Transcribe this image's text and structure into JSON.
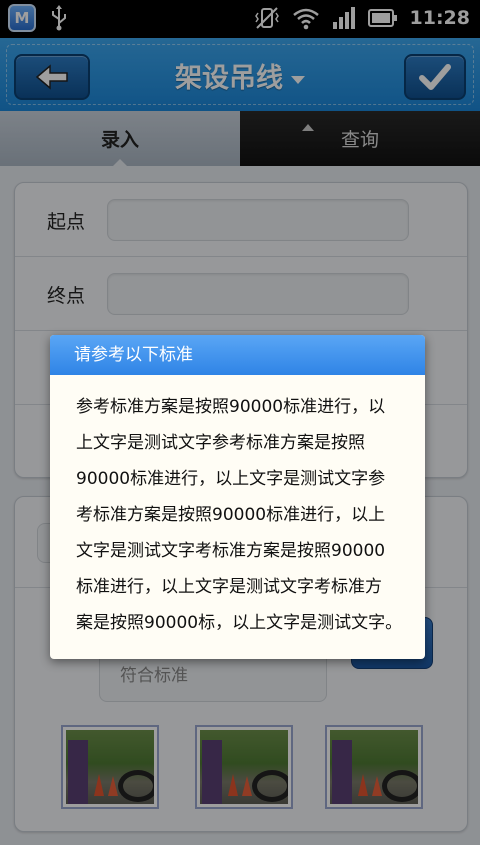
{
  "status_bar": {
    "time": "11:28",
    "icons": [
      "m-shield-icon",
      "usb-icon",
      "vibrate-icon",
      "wifi-icon",
      "signal-icon",
      "battery-icon"
    ]
  },
  "header": {
    "title": "架设吊线",
    "back_icon": "arrow-left-icon",
    "confirm_icon": "checkmark-icon"
  },
  "tabs": [
    {
      "label": "录入",
      "active": true
    },
    {
      "label": "查询",
      "active": false
    }
  ],
  "form": {
    "rows": [
      {
        "label": "起点",
        "value": ""
      },
      {
        "label": "终点",
        "value": ""
      }
    ],
    "status_placeholder": "符合标准"
  },
  "dialog": {
    "title": "请参考以下标准",
    "lines": [
      "参考标准方案是按照90000标准进行，以",
      "上文字是测试文字参考标准方案是按照",
      "90000标准进行，以上文字是测试文字参",
      "考标准方案是按照90000标准进行，以上",
      "文字是测试文字考标准方案是按照90000",
      "标准进行，以上文字是测试文字考标准方",
      "案是按照90000标，以上文字是测试文字。"
    ]
  },
  "colors": {
    "header_blue": "#1b86d8",
    "dialog_header_blue": "#2f84e6"
  }
}
